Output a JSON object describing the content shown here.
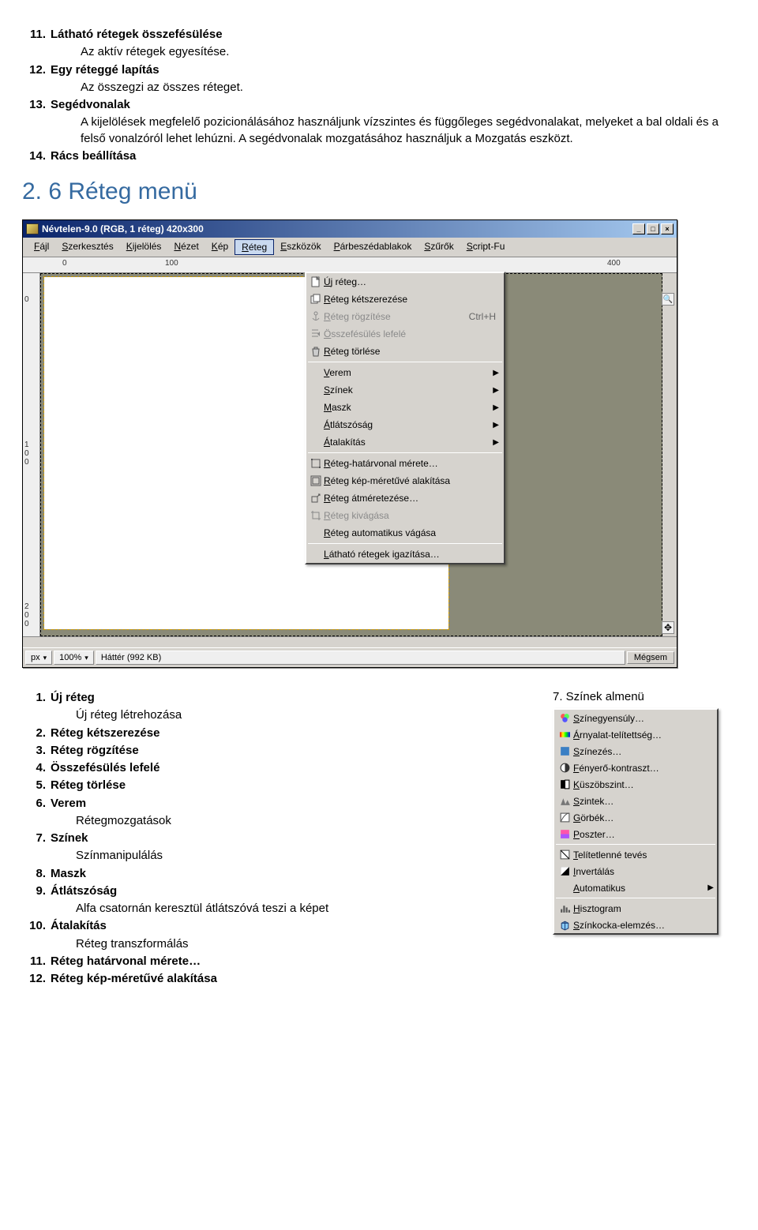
{
  "top_list": [
    {
      "n": "11.",
      "title": "Látható rétegek összefésülése",
      "body": "Az aktív rétegek egyesítése."
    },
    {
      "n": "12.",
      "title": "Egy réteggé lapítás",
      "body": "Az összegzi az összes réteget."
    },
    {
      "n": "13.",
      "title": "Segédvonalak",
      "body": "A kijelölések megfelelő pozicionálásához használjunk vízszintes és függőleges segédvonalakat, melyeket a bal oldali és a felső vonalzóról lehet lehúzni. A segédvonalak mozgatásához használjuk a Mozgatás eszközt."
    },
    {
      "n": "14.",
      "title": "Rács beállítása",
      "body": ""
    }
  ],
  "heading": "2. 6 Réteg menü",
  "window": {
    "title": "Névtelen-9.0 (RGB, 1 réteg) 420x300",
    "menus": [
      "Fájl",
      "Szerkesztés",
      "Kijelölés",
      "Nézet",
      "Kép",
      "Réteg",
      "Eszközök",
      "Párbeszédablakok",
      "Szűrők",
      "Script-Fu"
    ],
    "ruler_h": {
      "t0": "0",
      "t1": "100",
      "t2": "400"
    },
    "ruler_v": [
      "0",
      "1 0 0",
      "2 0 0"
    ],
    "dropdown": [
      {
        "type": "item",
        "ic": "doc",
        "text": "Új réteg…"
      },
      {
        "type": "item",
        "ic": "dup",
        "text": "Réteg kétszerezése"
      },
      {
        "type": "item",
        "ic": "anchor",
        "text": "Réteg rögzítése",
        "short": "Ctrl+H",
        "disabled": true
      },
      {
        "type": "item",
        "ic": "merge",
        "text": "Összefésülés lefelé",
        "disabled": true
      },
      {
        "type": "item",
        "ic": "trash",
        "text": "Réteg törlése"
      },
      {
        "type": "sep"
      },
      {
        "type": "sub",
        "text": "Verem"
      },
      {
        "type": "sub",
        "text": "Színek"
      },
      {
        "type": "sub",
        "text": "Maszk"
      },
      {
        "type": "sub",
        "text": "Átlátszóság"
      },
      {
        "type": "sub",
        "text": "Átalakítás"
      },
      {
        "type": "sep"
      },
      {
        "type": "item",
        "ic": "bounds",
        "text": "Réteg-határvonal mérete…"
      },
      {
        "type": "item",
        "ic": "fit",
        "text": "Réteg kép-méretűvé alakítása"
      },
      {
        "type": "item",
        "ic": "scale",
        "text": "Réteg átméretezése…"
      },
      {
        "type": "item",
        "ic": "crop",
        "text": "Réteg kivágása",
        "disabled": true
      },
      {
        "type": "item",
        "text": "Réteg automatikus vágása"
      },
      {
        "type": "sep"
      },
      {
        "type": "item",
        "text": "Látható rétegek igazítása…"
      }
    ],
    "status": {
      "unit": "px",
      "zoom": "100%",
      "bg": "Háttér (992 KB)",
      "cancel": "Mégsem"
    }
  },
  "bottom_list": [
    {
      "n": "1.",
      "title": "Új réteg",
      "body": "Új réteg létrehozása"
    },
    {
      "n": "2.",
      "title": "Réteg kétszerezése",
      "body": ""
    },
    {
      "n": "3.",
      "title": "Réteg rögzítése",
      "body": ""
    },
    {
      "n": "4.",
      "title": "Összefésülés lefelé",
      "body": ""
    },
    {
      "n": "5.",
      "title": "Réteg törlése",
      "body": ""
    },
    {
      "n": "6.",
      "title": "Verem",
      "body": "Rétegmozgatások"
    },
    {
      "n": "7.",
      "title": "Színek",
      "body": "Színmanipulálás"
    },
    {
      "n": "8.",
      "title": "Maszk",
      "body": ""
    },
    {
      "n": "9.",
      "title": "Átlátszóság",
      "body": "Alfa csatornán keresztül átlátszóvá teszi a képet"
    },
    {
      "n": "10.",
      "title": "Átalakítás",
      "body": "Réteg transzformálás"
    },
    {
      "n": "11.",
      "title": "Réteg határvonal mérete…",
      "body": ""
    },
    {
      "n": "12.",
      "title": "Réteg kép-méretűvé alakítása",
      "body": ""
    }
  ],
  "submenu_title": "7. Színek almenü",
  "submenu": [
    {
      "ic": "balance",
      "text": "Színegyensúly…"
    },
    {
      "ic": "huesat",
      "text": "Árnyalat-telítettség…"
    },
    {
      "ic": "colorize",
      "text": "Színezés…"
    },
    {
      "ic": "bricon",
      "text": "Fényerő-kontraszt…"
    },
    {
      "ic": "thresh",
      "text": "Küszöbszint…"
    },
    {
      "ic": "levels",
      "text": "Szintek…"
    },
    {
      "ic": "curves",
      "text": "Görbék…"
    },
    {
      "ic": "poster",
      "text": "Poszter…"
    },
    {
      "type": "sep"
    },
    {
      "ic": "desat",
      "text": "Telítetlenné tevés"
    },
    {
      "ic": "invert",
      "text": "Invertálás"
    },
    {
      "type": "sub",
      "text": "Automatikus"
    },
    {
      "type": "sep"
    },
    {
      "ic": "histo",
      "text": "Hisztogram"
    },
    {
      "ic": "cube",
      "text": "Színkocka-elemzés…"
    }
  ]
}
